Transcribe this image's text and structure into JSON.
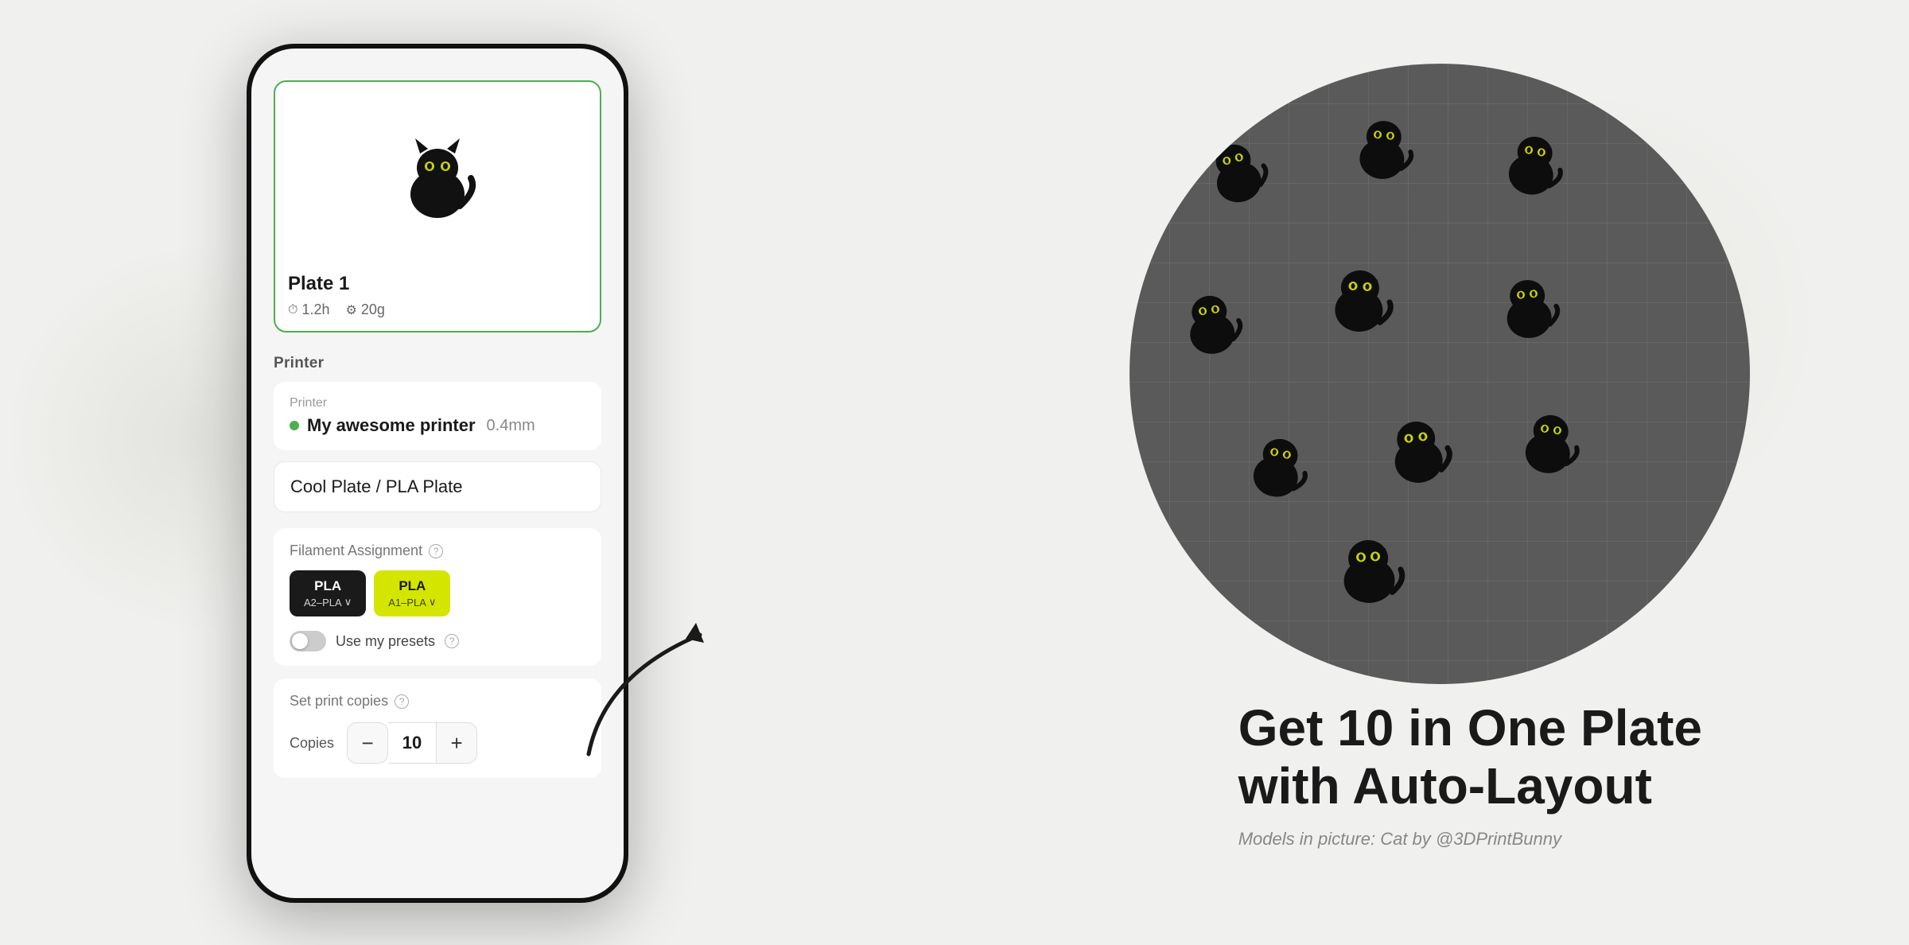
{
  "background": {
    "color": "#f0f0ee"
  },
  "phone": {
    "plate_card": {
      "title": "Plate 1",
      "time": "1.2h",
      "weight": "20g"
    },
    "printer_section": {
      "label": "Printer",
      "sublabel": "Printer",
      "name": "My awesome printer",
      "nozzle": "0.4mm",
      "status": "online"
    },
    "plate_type": {
      "value": "Cool Plate / PLA Plate"
    },
    "filament": {
      "label": "Filament Assignment",
      "info_icon": "ⓘ",
      "btn1_type": "PLA",
      "btn1_sub": "A2–PLA",
      "btn2_type": "PLA",
      "btn2_sub": "A1–PLA",
      "toggle_label": "Use my presets",
      "toggle_active": false
    },
    "copies": {
      "label": "Set print copies",
      "row_label": "Copies",
      "value": 10,
      "minus": "−",
      "plus": "+"
    }
  },
  "promo": {
    "title_line1": "Get 10 in One Plate",
    "title_line2": "with Auto-Layout",
    "caption": "Models in picture: Cat by @3DPrintBunny"
  },
  "icons": {
    "clock": "⏱",
    "weight": "⚖",
    "chevron_down": "∨",
    "info": "?"
  }
}
